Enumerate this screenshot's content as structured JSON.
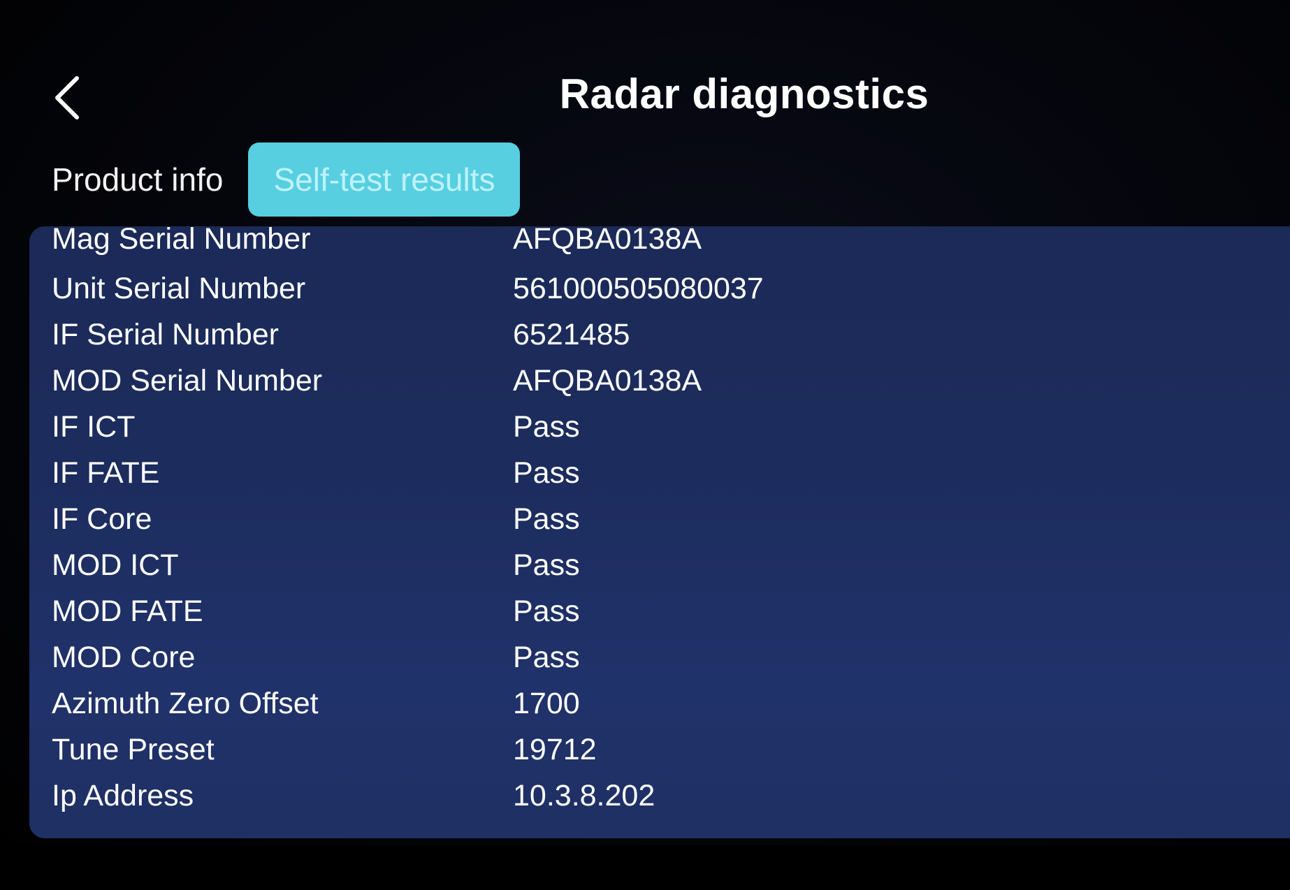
{
  "header": {
    "title": "Radar diagnostics",
    "back_icon": "chevron-left-icon"
  },
  "tabs": [
    {
      "label": "Product info",
      "active": false
    },
    {
      "label": "Self-test results",
      "active": true
    }
  ],
  "colors": {
    "accent": "#57cfe0",
    "panel": "#1d2d5e",
    "background": "#000000"
  },
  "rows": [
    {
      "label": "Mag Serial Number",
      "value": "AFQBA0138A"
    },
    {
      "label": "Unit Serial Number",
      "value": "561000505080037"
    },
    {
      "label": "IF Serial Number",
      "value": "6521485"
    },
    {
      "label": "MOD Serial Number",
      "value": "AFQBA0138A"
    },
    {
      "label": "IF ICT",
      "value": "Pass"
    },
    {
      "label": "IF FATE",
      "value": "Pass"
    },
    {
      "label": "IF Core",
      "value": "Pass"
    },
    {
      "label": "MOD ICT",
      "value": "Pass"
    },
    {
      "label": "MOD FATE",
      "value": "Pass"
    },
    {
      "label": "MOD Core",
      "value": "Pass"
    },
    {
      "label": "Azimuth Zero Offset",
      "value": "1700"
    },
    {
      "label": "Tune Preset",
      "value": "19712"
    },
    {
      "label": "Ip Address",
      "value": "10.3.8.202"
    }
  ]
}
